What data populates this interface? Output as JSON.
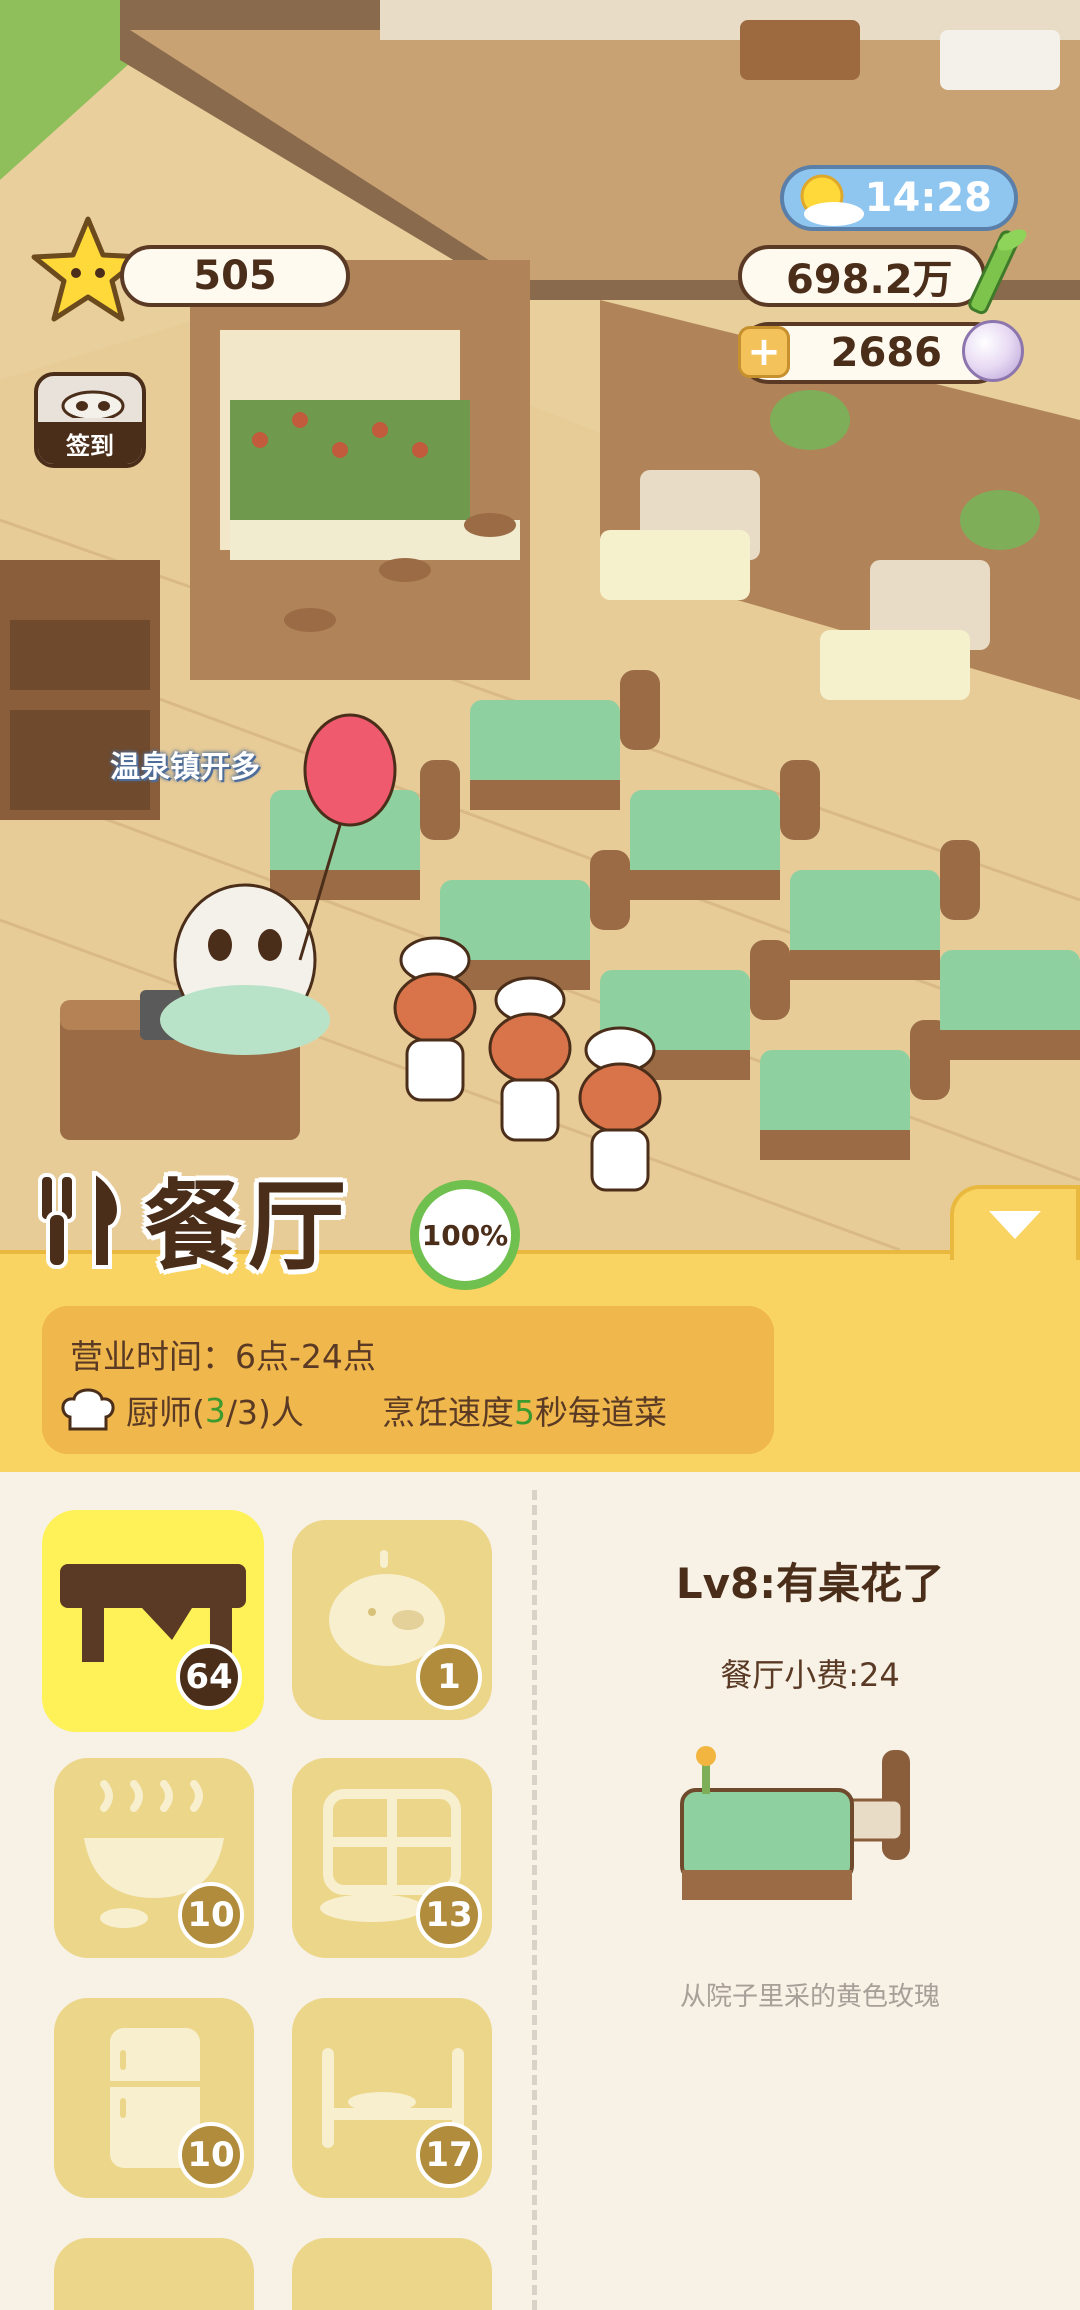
{
  "hud": {
    "stars": "505",
    "time": "14:28",
    "money": "698.2万",
    "pearls": "2686",
    "signin_label": "签到"
  },
  "scene": {
    "town_sign": "温泉镇开多"
  },
  "restaurant": {
    "name": "餐厅",
    "completion": "100%",
    "hours_label": "营业时间：",
    "hours_value": "6点-24点",
    "chef_label": "厨师(",
    "chef_current": "3",
    "chef_rest": "/3)人",
    "speed_label": "烹饪速度",
    "speed_value": "5",
    "speed_unit": "秒每道菜"
  },
  "categories": [
    {
      "icon": "table-icon",
      "count": "64",
      "active": true
    },
    {
      "icon": "piggy-bank-icon",
      "count": "1",
      "active": false
    },
    {
      "icon": "stove-pot-icon",
      "count": "10",
      "active": false
    },
    {
      "icon": "shelf-icon",
      "count": "13",
      "active": false
    },
    {
      "icon": "fridge-icon",
      "count": "10",
      "active": false
    },
    {
      "icon": "counter-icon",
      "count": "17",
      "active": false
    }
  ],
  "detail": {
    "title": "Lv8:有桌花了",
    "tip": "餐厅小费:24",
    "description": "从院子里采的黄色玫瑰"
  },
  "colors": {
    "accent_yellow": "#f9d463",
    "active_slot": "#fef258",
    "slot": "#ecd68a",
    "brown": "#4b2e1a",
    "green": "#6fc04e"
  }
}
